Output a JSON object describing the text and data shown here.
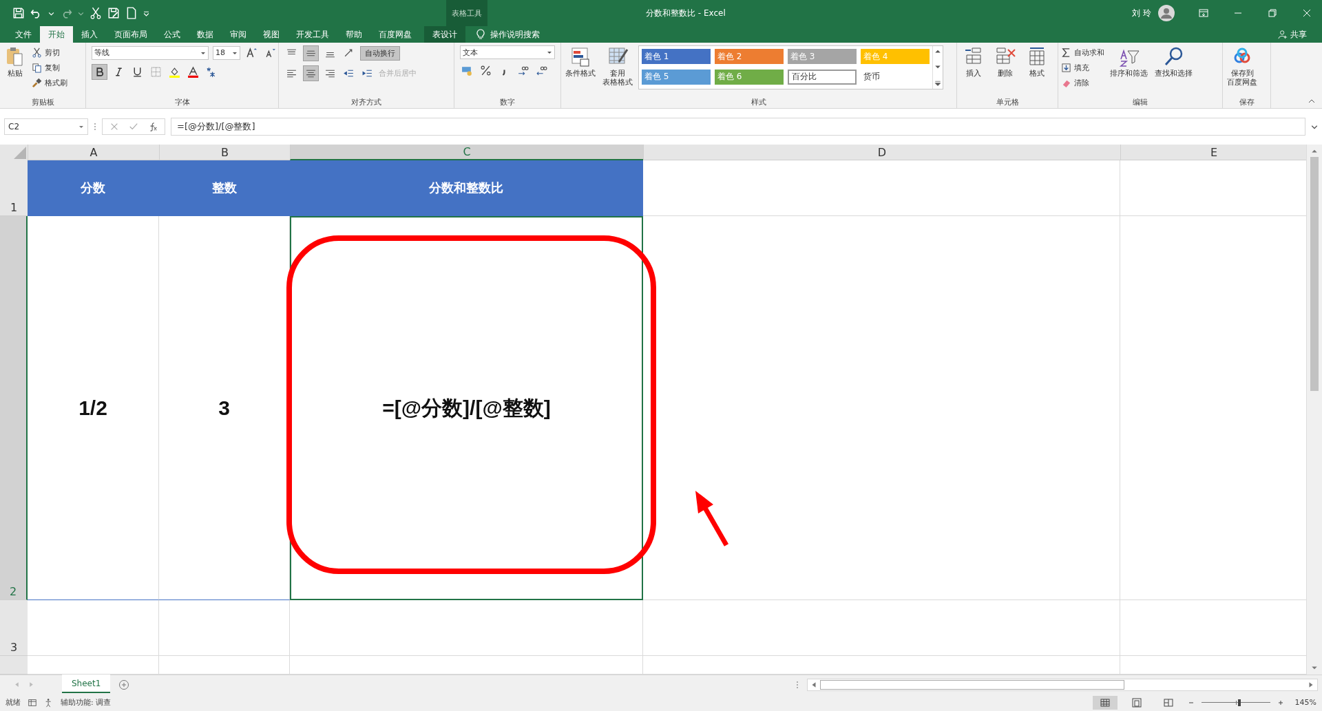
{
  "title_bar": {
    "context_group": "表格工具",
    "document": "分数和整数比  -  Excel",
    "user": "刘 玲"
  },
  "tabs": [
    {
      "label": "文件",
      "selected": false,
      "kind": "normal"
    },
    {
      "label": "开始",
      "selected": true,
      "kind": "normal"
    },
    {
      "label": "插入",
      "selected": false,
      "kind": "normal"
    },
    {
      "label": "页面布局",
      "selected": false,
      "kind": "normal"
    },
    {
      "label": "公式",
      "selected": false,
      "kind": "normal"
    },
    {
      "label": "数据",
      "selected": false,
      "kind": "normal"
    },
    {
      "label": "审阅",
      "selected": false,
      "kind": "normal"
    },
    {
      "label": "视图",
      "selected": false,
      "kind": "normal"
    },
    {
      "label": "开发工具",
      "selected": false,
      "kind": "normal"
    },
    {
      "label": "帮助",
      "selected": false,
      "kind": "normal"
    },
    {
      "label": "百度网盘",
      "selected": false,
      "kind": "normal"
    },
    {
      "label": "表设计",
      "selected": false,
      "kind": "context"
    }
  ],
  "tell_me": "操作说明搜索",
  "share": "共享",
  "ribbon": {
    "clipboard": {
      "paste": "粘贴",
      "cut": "剪切",
      "copy": "复制",
      "painter": "格式刷",
      "label": "剪贴板"
    },
    "font": {
      "name": "等线",
      "size": "18",
      "label": "字体"
    },
    "alignment": {
      "wrap": "自动换行",
      "merge": "合并后居中",
      "label": "对齐方式"
    },
    "number": {
      "format": "文本",
      "label": "数字"
    },
    "styles": {
      "conditional": "条件格式",
      "table_top": "套用",
      "table_bottom": "表格格式",
      "label": "样式",
      "cells": [
        {
          "label": "着色 1",
          "kind": "accent",
          "color": "#4472c4"
        },
        {
          "label": "着色 2",
          "kind": "accent",
          "color": "#ed7d31"
        },
        {
          "label": "着色 3",
          "kind": "accent",
          "color": "#a5a5a5"
        },
        {
          "label": "着色 4",
          "kind": "accent",
          "color": "#ffc000"
        },
        {
          "label": "着色 5",
          "kind": "accent",
          "color": "#5b9bd5"
        },
        {
          "label": "着色 6",
          "kind": "accent",
          "color": "#70ad47"
        },
        {
          "label": "百分比",
          "kind": "framed"
        },
        {
          "label": "货币",
          "kind": "plain"
        }
      ]
    },
    "cells": {
      "insert": "插入",
      "delete": "删除",
      "format": "格式",
      "label": "单元格"
    },
    "editing": {
      "autosum": "自动求和",
      "fill": "填充",
      "clear": "清除",
      "sort": "排序和筛选",
      "find": "查找和选择",
      "label": "编辑"
    },
    "save": {
      "top": "保存到",
      "bottom": "百度网盘",
      "label": "保存"
    }
  },
  "formula_bar": {
    "name_box": "C2",
    "formula": "=[@分数]/[@整数]"
  },
  "columns": [
    {
      "label": "A",
      "selected": false
    },
    {
      "label": "B",
      "selected": false
    },
    {
      "label": "C",
      "selected": true
    },
    {
      "label": "D",
      "selected": false
    },
    {
      "label": "E",
      "selected": false
    }
  ],
  "rows": [
    {
      "number": "1",
      "kind": "header",
      "selected": false,
      "cells": [
        {
          "text": "分数"
        },
        {
          "text": "整数"
        },
        {
          "text": "分数和整数比"
        }
      ]
    },
    {
      "number": "2",
      "kind": "data",
      "selected": true,
      "cells": [
        {
          "text": "1/2"
        },
        {
          "text": "3"
        },
        {
          "text": "=[@分数]/[@整数]"
        }
      ]
    },
    {
      "number": "3",
      "kind": "empty",
      "selected": false,
      "cells": []
    }
  ],
  "sheets": [
    {
      "label": "Sheet1",
      "selected": true
    }
  ],
  "status_bar": {
    "ready": "就绪",
    "accessibility": "辅助功能: 调查",
    "zoom": "145%",
    "zoom_level": {
      "level": 0.55
    }
  }
}
